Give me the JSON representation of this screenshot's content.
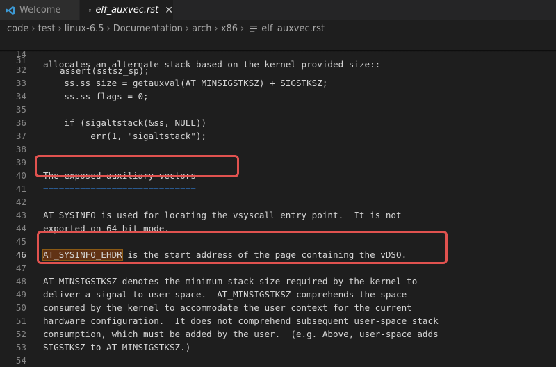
{
  "tabs": [
    {
      "label": "Welcome",
      "icon": "vscode-icon"
    },
    {
      "label": "elf_auxvec.rst",
      "icon": "list-icon",
      "close": "✕"
    }
  ],
  "breadcrumb": {
    "items": [
      "code",
      "test",
      "linux-6.5",
      "Documentation",
      "arch",
      "x86"
    ],
    "file": "elf_auxvec.rst",
    "separator": "›"
  },
  "editor": {
    "sticky_line": {
      "number": "14",
      "text": "allocates an alternate stack based on the kernel-provided size::"
    },
    "partial_line": {
      "number": "31",
      "text": "assert(sstsz_sp);"
    },
    "lines": [
      {
        "number": "32",
        "text": ""
      },
      {
        "number": "33",
        "text": "    ss.ss_size = getauxval(AT_MINSIGSTKSZ) + SIGSTKSZ;"
      },
      {
        "number": "34",
        "text": "    ss.ss_flags = 0;"
      },
      {
        "number": "35",
        "text": ""
      },
      {
        "number": "36",
        "text": "    if (sigaltstack(&ss, NULL))"
      },
      {
        "number": "37",
        "text": "         err(1, \"sigaltstack\");"
      },
      {
        "number": "38",
        "text": ""
      },
      {
        "number": "39",
        "text": ""
      },
      {
        "number": "40",
        "text": "The exposed auxiliary vectors"
      },
      {
        "number": "41",
        "text": "============================="
      },
      {
        "number": "42",
        "text": ""
      },
      {
        "number": "43",
        "text": "AT_SYSINFO is used for locating the vsyscall entry point.  It is not"
      },
      {
        "number": "44",
        "text": "exported on 64-bit mode."
      },
      {
        "number": "45",
        "text": ""
      },
      {
        "number": "46",
        "highlight": "AT_SYSINFO_EHDR",
        "text": " is the start address of the page containing the vDSO."
      },
      {
        "number": "47",
        "text": ""
      },
      {
        "number": "48",
        "text": "AT_MINSIGSTKSZ denotes the minimum stack size required by the kernel to"
      },
      {
        "number": "49",
        "text": "deliver a signal to user-space.  AT_MINSIGSTKSZ comprehends the space"
      },
      {
        "number": "50",
        "text": "consumed by the kernel to accommodate the user context for the current"
      },
      {
        "number": "51",
        "text": "hardware configuration.  It does not comprehend subsequent user-space stack"
      },
      {
        "number": "52",
        "text": "consumption, which must be added by the user.  (e.g. Above, user-space adds"
      },
      {
        "number": "53",
        "text": "SIGSTKSZ to AT_MINSIGSTKSZ.)"
      },
      {
        "number": "54",
        "text": ""
      }
    ]
  },
  "colors": {
    "background": "#1e1e1e",
    "highlight_box": "#e0524f",
    "search_match": "#613214",
    "underline_text": "#3794ff"
  }
}
